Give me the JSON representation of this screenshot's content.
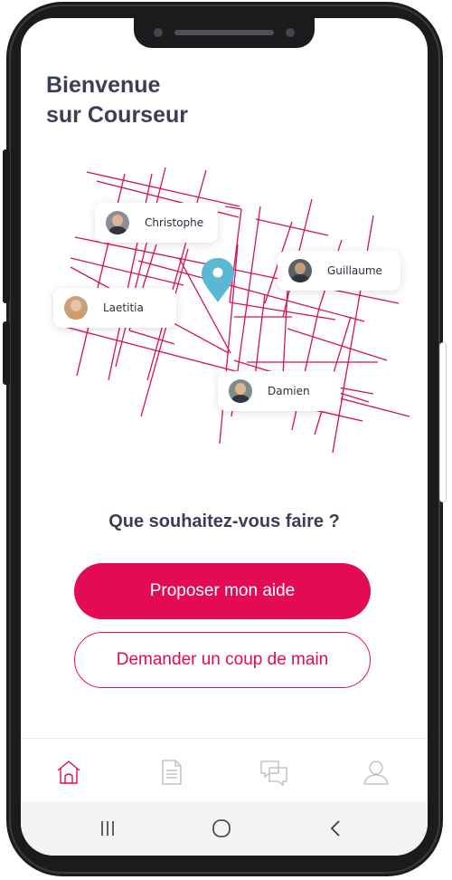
{
  "app": {
    "title_line1": "Bienvenue",
    "title_line2": "sur Courseur"
  },
  "map": {
    "people": [
      {
        "name": "Christophe",
        "avatar": "avatar-photo"
      },
      {
        "name": "Guillaume",
        "avatar": "avatar-photo"
      },
      {
        "name": "Laetitia",
        "avatar": "avatar-photo"
      },
      {
        "name": "Damien",
        "avatar": "avatar-photo"
      }
    ],
    "marker_icon": "location-pin-icon",
    "street_color": "#d6105a",
    "marker_color": "#5bb8d5"
  },
  "main": {
    "question": "Que souhaitez-vous faire ?",
    "primary_button": "Proposer mon aide",
    "secondary_button": "Demander un coup de main"
  },
  "tabbar": {
    "items": [
      {
        "icon": "home-icon",
        "active": true
      },
      {
        "icon": "document-icon",
        "active": false
      },
      {
        "icon": "chat-icon",
        "active": false
      },
      {
        "icon": "user-icon",
        "active": false
      }
    ]
  },
  "system_nav": {
    "items": [
      "recent-apps-icon",
      "home-circle-icon",
      "back-icon"
    ]
  },
  "colors": {
    "accent": "#e30b56",
    "title": "#3b3f56",
    "inactive_icon": "#b8b9c2"
  }
}
